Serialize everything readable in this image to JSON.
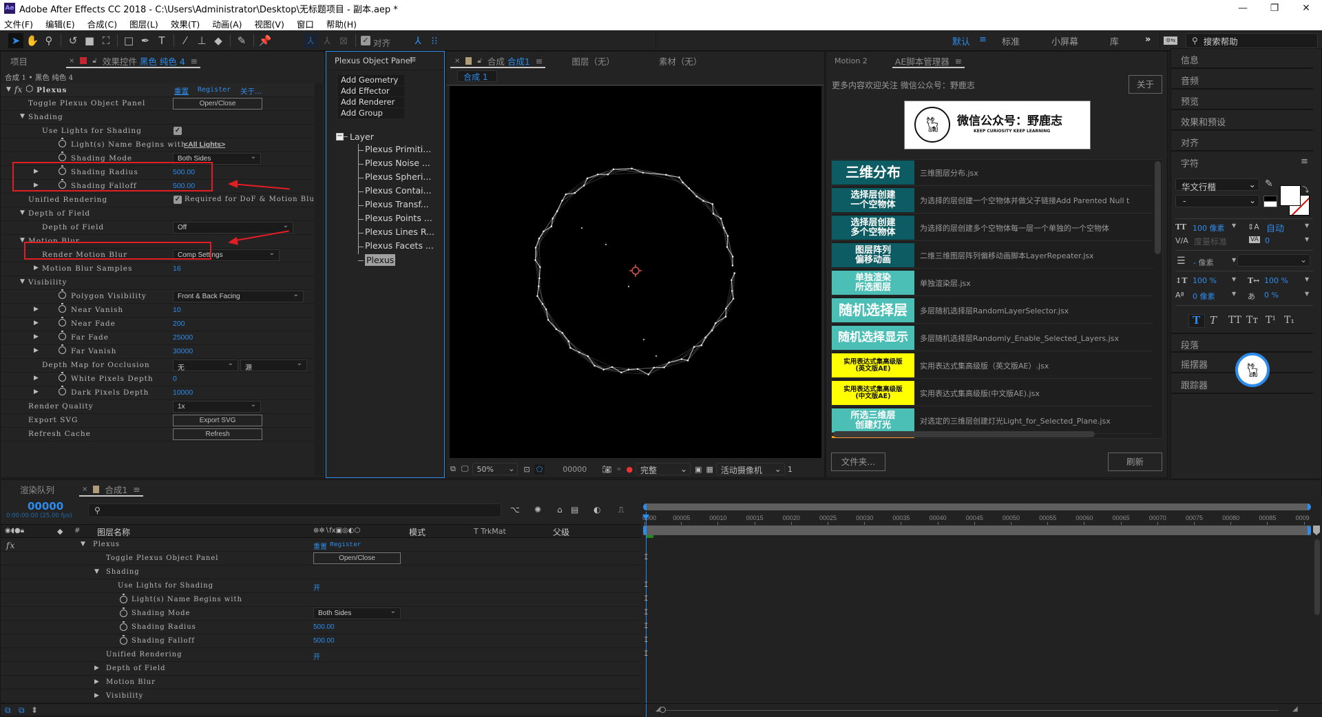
{
  "app": {
    "title": "Adobe After Effects CC 2018 - C:\\Users\\Administrator\\Desktop\\无标题项目 - 副本.aep *",
    "logo": "Ae",
    "window_controls": [
      "minimize-icon",
      "restore-icon",
      "close-icon"
    ]
  },
  "menu": [
    "文件(F)",
    "编辑(E)",
    "合成(C)",
    "图层(L)",
    "效果(T)",
    "动画(A)",
    "视图(V)",
    "窗口",
    "帮助(H)"
  ],
  "toolbar": {
    "tools": [
      "selection-tool",
      "hand-tool",
      "zoom-tool",
      "rotate-tool",
      "camera-tool",
      "pan-behind-tool",
      "rectangle-tool",
      "pen-tool",
      "type-tool",
      "brush-tool",
      "clone-stamp-tool",
      "eraser-tool",
      "roto-brush-tool",
      "puppet-pin-tool"
    ],
    "snap_label": "对齐",
    "snap_checked": true,
    "workspaces": [
      {
        "label": "默认",
        "active": true
      },
      {
        "label": "标准",
        "active": false
      },
      {
        "label": "小屏幕",
        "active": false
      },
      {
        "label": "库",
        "active": false
      }
    ],
    "overflow": "»",
    "search_placeholder": "搜索帮助"
  },
  "effect_panel": {
    "tabs": {
      "project": "项目",
      "effect_controls_prefix": "效果控件",
      "effect_controls_layer": "黑色 纯色 4"
    },
    "breadcrumb": "合成 1 • 黑色 纯色 4",
    "effect": {
      "name": "Plexus",
      "reset": "重置",
      "register": "Register",
      "about": "关于..."
    },
    "rows": [
      {
        "label": "Toggle Plexus Object Panel",
        "indent": 1,
        "button": "Open/Close"
      },
      {
        "label": "Shading",
        "indent": 1,
        "twirl": "open"
      },
      {
        "label": "Use Lights for Shading",
        "indent": 2,
        "checkbox": true
      },
      {
        "label": "Light(s) Name Begins with",
        "indent": 3,
        "stopwatch": true,
        "link": "<All Lights>"
      },
      {
        "label": "Shading Mode",
        "indent": 3,
        "stopwatch": true,
        "dropdown": "Both Sides"
      },
      {
        "label": "Shading Radius",
        "indent": 3,
        "stopwatch": true,
        "twirl": "closed",
        "value": "500.00"
      },
      {
        "label": "Shading Falloff",
        "indent": 3,
        "stopwatch": true,
        "twirl": "closed",
        "value": "500.00"
      },
      {
        "label": "Unified Rendering",
        "indent": 1,
        "checkbox": true,
        "checkbox_label": "Required for DoF & Motion Blur"
      },
      {
        "label": "Depth of Field",
        "indent": 1,
        "twirl": "open"
      },
      {
        "label": "Depth of Field",
        "indent": 2,
        "dropdown": "Off"
      },
      {
        "label": "Motion Blur",
        "indent": 1,
        "twirl": "open"
      },
      {
        "label": "Render Motion Blur",
        "indent": 2,
        "dropdown": "Comp Settings"
      },
      {
        "label": "Motion Blur Samples",
        "indent": 2,
        "twirl": "closed",
        "value": "16"
      },
      {
        "label": "Visibility",
        "indent": 1,
        "twirl": "open"
      },
      {
        "label": "Polygon Visibility",
        "indent": 3,
        "stopwatch": true,
        "dropdown": "Front & Back Facing"
      },
      {
        "label": "Near Vanish",
        "indent": 3,
        "stopwatch": true,
        "twirl": "closed",
        "value": "10"
      },
      {
        "label": "Near Fade",
        "indent": 3,
        "stopwatch": true,
        "twirl": "closed",
        "value": "200"
      },
      {
        "label": "Far Fade",
        "indent": 3,
        "stopwatch": true,
        "twirl": "closed",
        "value": "25000"
      },
      {
        "label": "Far Vanish",
        "indent": 3,
        "stopwatch": true,
        "twirl": "closed",
        "value": "30000"
      },
      {
        "label": "Depth Map for Occlusion",
        "indent": 2,
        "dropdown2": [
          "无",
          "源"
        ]
      },
      {
        "label": "White Pixels Depth",
        "indent": 3,
        "stopwatch": true,
        "twirl": "closed",
        "value": "0"
      },
      {
        "label": "Dark Pixels Depth",
        "indent": 3,
        "stopwatch": true,
        "twirl": "closed",
        "value": "10000"
      },
      {
        "label": "Render Quality",
        "indent": 1,
        "dropdown": "1x"
      },
      {
        "label": "Export SVG",
        "indent": 1,
        "button": "Export SVG"
      },
      {
        "label": "Refresh Cache",
        "indent": 1,
        "button": "Refresh"
      }
    ]
  },
  "plexus_panel": {
    "title": "Plexus Object Panel",
    "buttons": [
      "Add Geometry",
      "Add Effector",
      "Add Renderer",
      "Add Group"
    ],
    "tree_root": "Layer",
    "tree_items": [
      "Plexus Primiti...",
      "Plexus Noise ...",
      "Plexus Spheri...",
      "Plexus Contai...",
      "Plexus Transf...",
      "Plexus Points ...",
      "Plexus Lines R...",
      "Plexus Facets ...",
      "Plexus"
    ],
    "selected_item": "Plexus"
  },
  "comp_viewer": {
    "tabs": {
      "comp_prefix": "合成",
      "comp_name": "合成1",
      "layer": "图层（无）",
      "footage": "素材（无）"
    },
    "comp_chip": "合成 1",
    "footer": {
      "zoom": "50%",
      "timecode": "00000",
      "resolution": "完整",
      "camera": "活动摄像机",
      "views": "1"
    }
  },
  "script_manager": {
    "tabs": [
      "Motion 2",
      "AE脚本管理器"
    ],
    "notice": "更多内容欢迎关注 微信公众号：野鹿志",
    "about_button": "关于",
    "banner": {
      "title": "微信公众号：野鹿志",
      "subtitle": "KEEP CURIOSITY KEEP LEARNING",
      "logo_text": "野鹿志"
    },
    "scripts": [
      {
        "icon_text": "三维分布",
        "desc": "三维图层分布.jsx",
        "bg": "#0d5c63",
        "fg": "#ffffff",
        "size": "big"
      },
      {
        "icon_text": "选择层创建\n一个空物体",
        "desc": "为选择的层创建一个空物体并做父子链接Add Parented Null t",
        "bg": "#0d5c63",
        "fg": "#ffffff",
        "size": "mid"
      },
      {
        "icon_text": "选择层创建\n多个空物体",
        "desc": "为选择的层创建多个空物体每一层一个单独的一个空物体",
        "bg": "#0d5c63",
        "fg": "#ffffff",
        "size": "mid"
      },
      {
        "icon_text": "图层阵列\n偏移动画",
        "desc": "二维三维图层阵列偏移动画脚本LayerRepeater.jsx",
        "bg": "#0d5c63",
        "fg": "#ffffff",
        "size": "mid"
      },
      {
        "icon_text": "单独渲染\n所选图层",
        "desc": "单独渲染层.jsx",
        "bg": "#4bbfb5",
        "fg": "#ffffff",
        "size": "mid"
      },
      {
        "icon_text": "随机选择层",
        "desc": "多层随机选择层RandomLayerSelector.jsx",
        "bg": "#4bbfb5",
        "fg": "#ffffff",
        "size": "big"
      },
      {
        "icon_text": "随机选择显示",
        "desc": "多层随机选择层Randomly_Enable_Selected_Layers.jsx",
        "bg": "#4bbfb5",
        "fg": "#ffffff",
        "size": "bigsm"
      },
      {
        "icon_text": "实用表达式集高级版\n(英文版AE)",
        "desc": "实用表达式集高级版（英文版AE）.jsx",
        "bg": "#ffff00",
        "fg": "#111111",
        "size": "small"
      },
      {
        "icon_text": "实用表达式集高级版\n(中文版AE)",
        "desc": "实用表达式集高级版(中文版AE).jsx",
        "bg": "#ffff00",
        "fg": "#111111",
        "size": "small"
      },
      {
        "icon_text": "所选三维层\n创建灯光",
        "desc": "对选定的三维层创建灯光Light_for_Selected_Plane.jsx",
        "bg": "#4bbfb5",
        "fg": "#ffffff",
        "size": "mid"
      }
    ],
    "folder_button": "文件夹...",
    "refresh_button": "刷新"
  },
  "right_panels": {
    "items": [
      "信息",
      "音频",
      "预览",
      "效果和预设",
      "对齐"
    ],
    "character": {
      "title": "字符",
      "font": "华文行楷",
      "style": "-",
      "size": "100 像素",
      "leading": "自动",
      "kerning": "度量标准",
      "tracking": "0",
      "stroke": "- 像素",
      "vscale": "100 %",
      "hscale": "100 %",
      "baseline": "0 像素",
      "tsume": "0 %",
      "styles": [
        "T",
        "T",
        "TT",
        "Tт",
        "T¹",
        "T₁"
      ]
    },
    "bottom_items": [
      "段落",
      "摇摆器",
      "跟踪器"
    ]
  },
  "timeline": {
    "tabs": {
      "render_queue": "渲染队列",
      "comp": "合成1"
    },
    "timecode": "00000",
    "timecode_sub": "0:00:00:00 (25.00 fps)",
    "search_placeholder": "",
    "columns": {
      "name": "图层名称",
      "mode": "模式",
      "trkmat": "T  TrkMat",
      "parent": "父级",
      "num": "#"
    },
    "ruler_ticks": [
      "0000",
      "00005",
      "00010",
      "00015",
      "00020",
      "00025",
      "00030",
      "00035",
      "00040",
      "00045",
      "00050",
      "00055",
      "00060",
      "00065",
      "00070",
      "00075",
      "00080",
      "00085",
      "0009"
    ],
    "rows": [
      {
        "label": "Plexus",
        "indent": 0,
        "twirl": "open",
        "links": [
          "重置",
          "Register"
        ]
      },
      {
        "label": "Toggle Plexus Object Panel",
        "indent": 1,
        "button": "Open/Close"
      },
      {
        "label": "Shading",
        "indent": 1,
        "twirl": "open"
      },
      {
        "label": "Use Lights for Shading",
        "indent": 2,
        "value": "开"
      },
      {
        "label": "Light(s) Name Begins with",
        "indent": 2,
        "stopwatch": true
      },
      {
        "label": "Shading Mode",
        "indent": 2,
        "stopwatch": true,
        "dropdown": "Both Sides"
      },
      {
        "label": "Shading Radius",
        "indent": 2,
        "stopwatch": true,
        "value": "500.00"
      },
      {
        "label": "Shading Falloff",
        "indent": 2,
        "stopwatch": true,
        "value": "500.00"
      },
      {
        "label": "Unified Rendering",
        "indent": 1,
        "value": "开"
      },
      {
        "label": "Depth of Field",
        "indent": 1,
        "twirl": "closed"
      },
      {
        "label": "Motion Blur",
        "indent": 1,
        "twirl": "closed"
      },
      {
        "label": "Visibility",
        "indent": 1,
        "twirl": "closed"
      }
    ]
  },
  "colors": {
    "accent": "#2d8ceb",
    "annotation_red": "#e21e24",
    "panel_bg": "#232323"
  }
}
